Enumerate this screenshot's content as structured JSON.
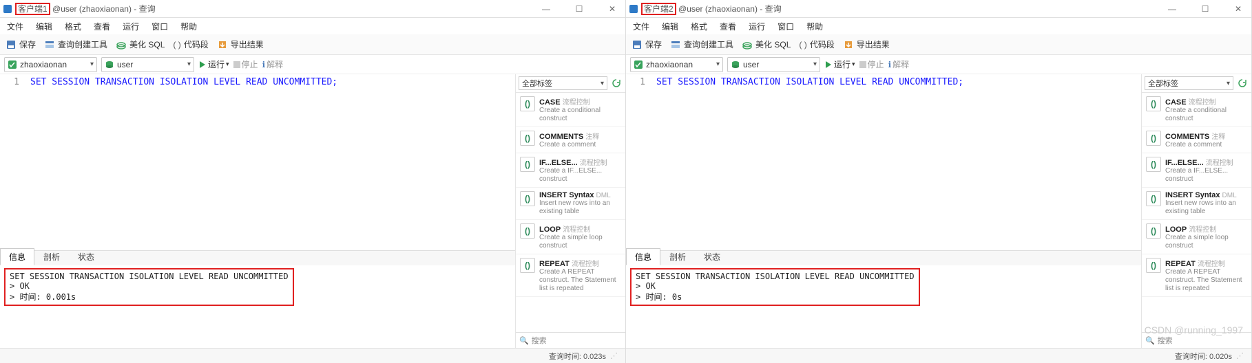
{
  "panes": [
    {
      "title_client": "客户端1",
      "title_rest": "@user (zhaoxiaonan) - 查询",
      "query_time": "查询时间: 0.023s",
      "output_time": "时间: 0.001s"
    },
    {
      "title_client": "客户端2",
      "title_rest": "@user (zhaoxiaonan) - 查询",
      "query_time": "查询时间: 0.020s",
      "output_time": "时间: 0s"
    }
  ],
  "menu": {
    "file": "文件",
    "edit": "编辑",
    "format": "格式",
    "view": "查看",
    "run": "运行",
    "window": "窗口",
    "help": "帮助"
  },
  "toolbar": {
    "save": "保存",
    "builder": "查询创建工具",
    "beautify": "美化 SQL",
    "snippet": "代码段",
    "export": "导出结果"
  },
  "row3": {
    "conn": "zhaoxiaonan",
    "db": "user",
    "run": "运行",
    "stop": "停止",
    "explain": "解释"
  },
  "code": "SET SESSION TRANSACTION ISOLATION LEVEL READ UNCOMMITTED;",
  "code_semicolon": ";",
  "tabs": {
    "info": "信息",
    "analyze": "剖析",
    "status": "状态"
  },
  "output": {
    "sql": "SET SESSION TRANSACTION ISOLATION LEVEL READ UNCOMMITTED",
    "ok": "OK"
  },
  "sidebar": {
    "all_tags": "全部标签",
    "search": "搜索",
    "items": [
      {
        "t": "CASE",
        "tag": "流程控制",
        "sub": "Create a conditional construct"
      },
      {
        "t": "COMMENTS",
        "tag": "注释",
        "sub": "Create a comment"
      },
      {
        "t": "IF...ELSE...",
        "tag": "流程控制",
        "sub": "Create a IF...ELSE... construct"
      },
      {
        "t": "INSERT Syntax",
        "tag": "DML",
        "sub": "Insert new rows into an existing table"
      },
      {
        "t": "LOOP",
        "tag": "流程控制",
        "sub": "Create a simple loop construct"
      },
      {
        "t": "REPEAT",
        "tag": "流程控制",
        "sub": "Create A REPEAT construct. The Statement list is repeated"
      }
    ]
  },
  "watermark": "CSDN @running_1997"
}
